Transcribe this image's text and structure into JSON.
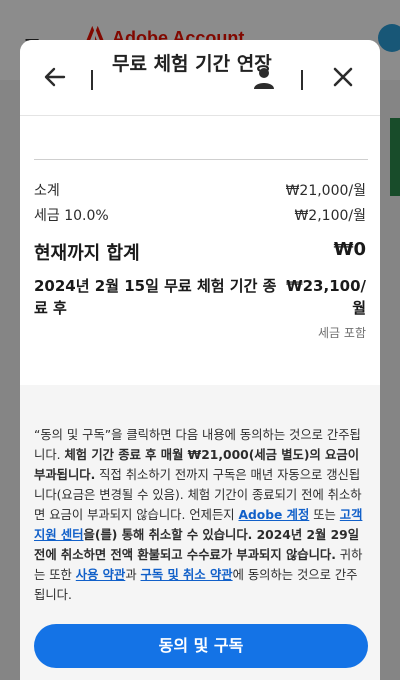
{
  "background": {
    "app_title": "Adobe Account",
    "menu_icon": "hamburger-menu-icon",
    "logo_icon": "adobe-logo-icon",
    "accent": "#eb1000"
  },
  "modal": {
    "title": "무료 체험 기간 연장",
    "back_icon": "back-arrow-icon",
    "user_icon": "user-icon",
    "close_icon": "close-icon"
  },
  "summary": {
    "subtotal_label": "소계",
    "subtotal_value": "₩21,000/월",
    "tax_label": "세금 10.0%",
    "tax_value": "₩2,100/월",
    "total_label": "현재까지 합계",
    "total_value": "₩0",
    "after_trial_label": "2024년 2월 15일 무료 체험 기간 종료 후",
    "after_trial_value": "₩23,100/월",
    "tax_included": "세금 포함"
  },
  "legal": {
    "p1": "“동의 및 구독”을 클릭하면 다음 내용에 동의하는 것으로 간주됩니다. ",
    "p2": "체험 기간 종료 후 매월 ₩21,000(세금 별도)의 요금이 부과됩니다.",
    "p3": " 직접 취소하기 전까지 구독은 매년 자동으로 갱신됩니다(요금은 변경될 수 있음). 체험 기간이 종료되기 전에 취소하면 요금이 부과되지 않습니다.",
    "p4": " 언제든지 ",
    "link_adobe_account": "Adobe 계정",
    "p5": " 또는 ",
    "link_support": "고객 지원 센터",
    "p6": "을(를) 통해 취소할 수 있습니다. 2024년 2월 29일 전에 취소하면 전액 환불되고 수수료가 부과되지 않습니다.",
    "p7": " 귀하는 또한 ",
    "link_terms": "사용 약관",
    "p8": "과 ",
    "link_cancel_terms": "구독 및 취소 약관",
    "p9": "에 동의하는 것으로 간주됩니다."
  },
  "subscribe_button": "동의 및 구독",
  "colors": {
    "primary": "#1473e6",
    "link": "#1160c9"
  }
}
